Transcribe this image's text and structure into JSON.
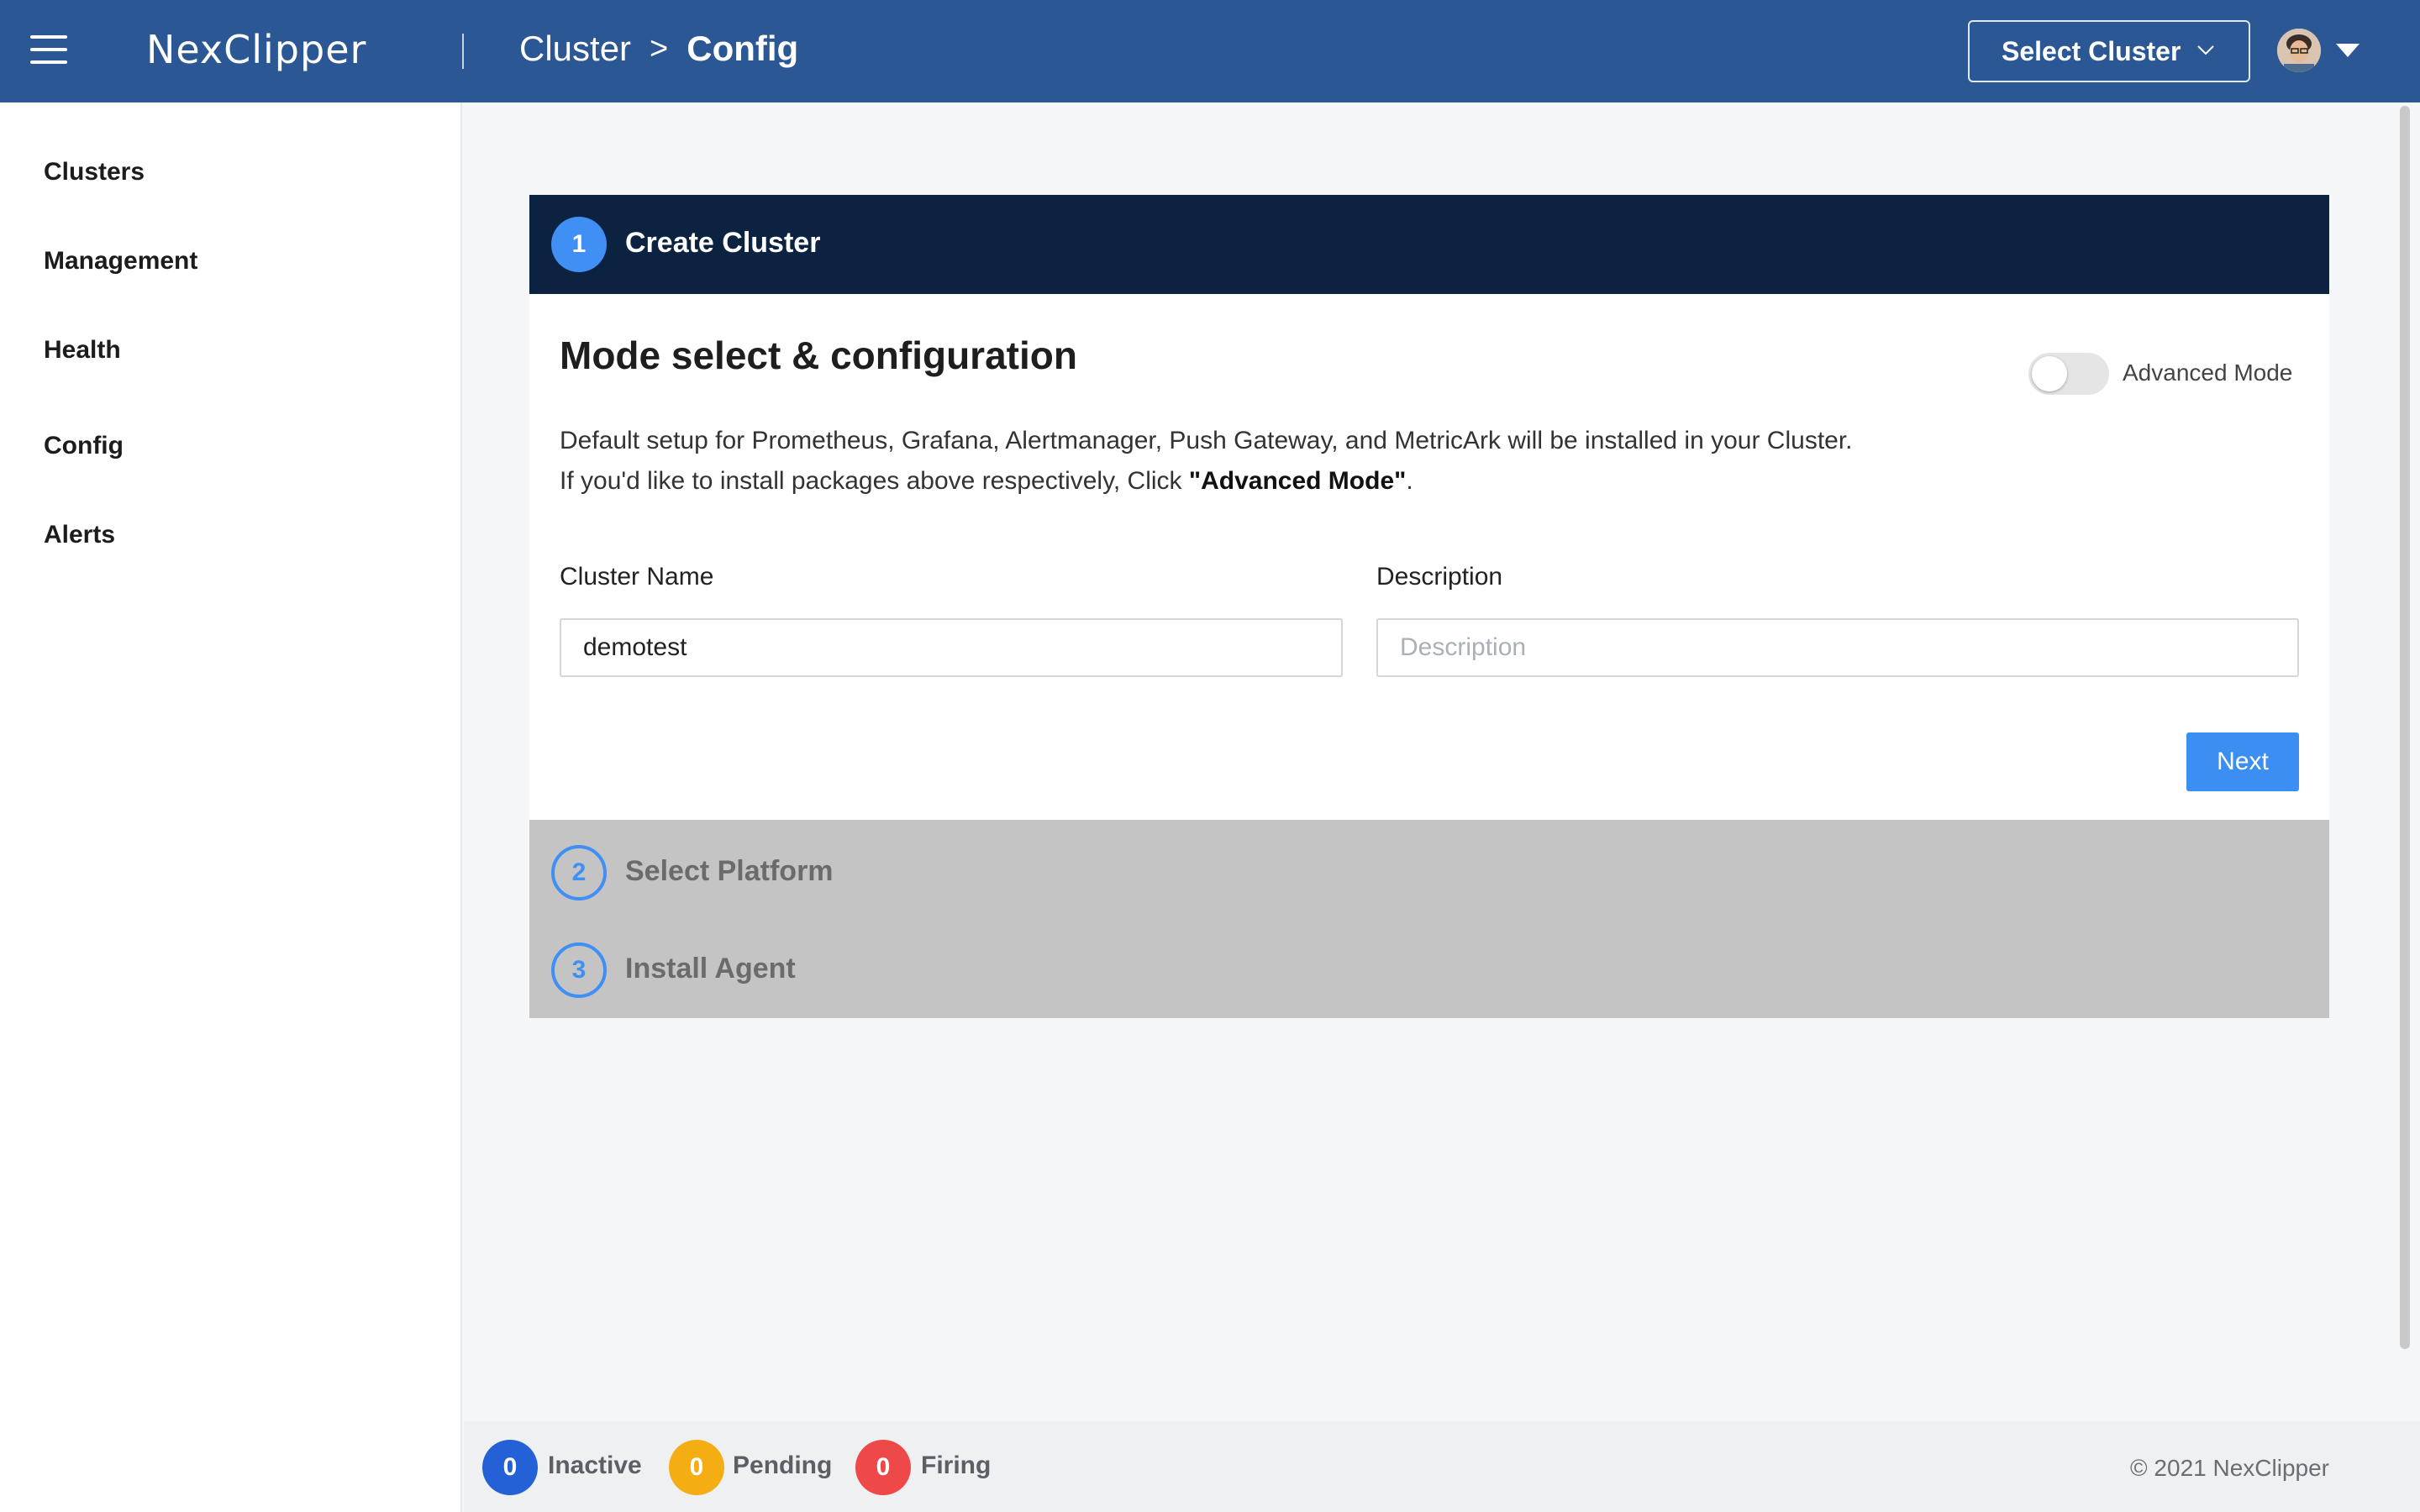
{
  "header": {
    "logo": "NexClipper",
    "breadcrumb": {
      "parent": "Cluster",
      "separator": ">",
      "current": "Config"
    },
    "select_cluster_label": "Select Cluster",
    "icons": {
      "menu": "hamburger-menu-icon",
      "dropdown": "chevron-down-icon",
      "user_caret": "caret-down-icon"
    }
  },
  "sidebar": {
    "items": [
      {
        "label": "Clusters"
      },
      {
        "label": "Management"
      },
      {
        "label": "Health"
      },
      {
        "label": "Config"
      },
      {
        "label": "Alerts"
      }
    ]
  },
  "wizard": {
    "step1": {
      "number": "1",
      "title": "Create Cluster"
    },
    "step2": {
      "number": "2",
      "title": "Select Platform"
    },
    "step3": {
      "number": "3",
      "title": "Install Agent"
    },
    "section_title": "Mode select & configuration",
    "advanced_mode_label": "Advanced Mode",
    "advanced_mode_on": false,
    "description_line1": "Default setup for Prometheus, Grafana, Alertmanager, Push Gateway, and MetricArk will be installed in your Cluster.",
    "description_line2_prefix": "If you'd like to install packages above respectively, Click ",
    "description_line2_bold": "\"Advanced Mode\"",
    "description_line2_suffix": ".",
    "cluster_name": {
      "label": "Cluster Name",
      "value": "demotest"
    },
    "description_field": {
      "label": "Description",
      "value": "",
      "placeholder": "Description"
    },
    "next_label": "Next"
  },
  "footer": {
    "inactive": {
      "count": "0",
      "label": "Inactive",
      "color": "#2461d6"
    },
    "pending": {
      "count": "0",
      "label": "Pending",
      "color": "#f5ad14"
    },
    "firing": {
      "count": "0",
      "label": "Firing",
      "color": "#ef4848"
    },
    "copyright": "© 2021 NexClipper"
  },
  "colors": {
    "header_bg": "#2b5795",
    "step_active_bg": "#0b2340",
    "accent": "#3f8ff5",
    "steps_inactive_bg": "#c4c4c4"
  }
}
